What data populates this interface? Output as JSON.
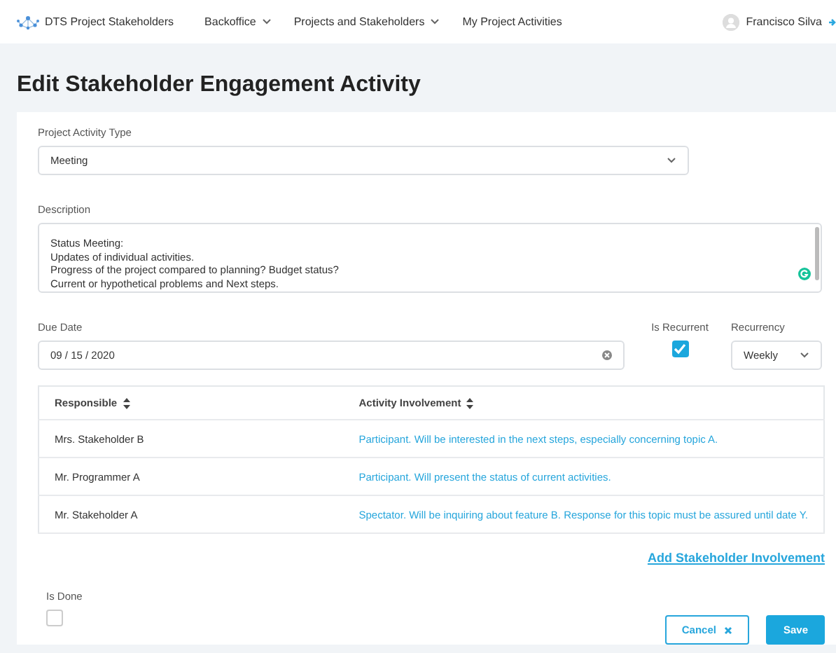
{
  "nav": {
    "brand": "DTS Project Stakeholders",
    "menus": [
      {
        "label": "Backoffice",
        "dropdown": true
      },
      {
        "label": "Projects and Stakeholders",
        "dropdown": true
      },
      {
        "label": "My Project Activities",
        "dropdown": false
      }
    ],
    "user": "Francisco Silva"
  },
  "title": "Edit Stakeholder Engagement Activity",
  "form": {
    "activity_type": {
      "label": "Project Activity Type",
      "value": "Meeting"
    },
    "description": {
      "label": "Description",
      "lines": [
        "Status Meeting:",
        "Updates of individual activities.",
        "Progress of the project compared to planning? Budget status?",
        "Current or hypothetical problems and Next steps."
      ]
    },
    "due_date": {
      "label": "Due Date",
      "value": "09 / 15 / 2020"
    },
    "is_recurrent": {
      "label": "Is Recurrent",
      "checked": true
    },
    "recurrency": {
      "label": "Recurrency",
      "value": "Weekly"
    }
  },
  "table": {
    "columns": [
      "Responsible",
      "Activity Involvement"
    ],
    "rows": [
      {
        "responsible": "Mrs. Stakeholder B",
        "involvement": "Participant. Will be interested in the next steps, especially concerning topic A."
      },
      {
        "responsible": "Mr. Programmer A",
        "involvement": "Participant. Will present the status of current activities."
      },
      {
        "responsible": "Mr. Stakeholder A",
        "involvement": "Spectator. Will be inquiring about feature B. Response for this topic must be assured until date Y."
      }
    ]
  },
  "add_link": "Add Stakeholder Involvement",
  "is_done": {
    "label": "Is Done",
    "checked": false
  },
  "buttons": [
    {
      "label": "Cancel",
      "kind": "secondary"
    },
    {
      "label": "Save",
      "kind": "primary"
    }
  ]
}
